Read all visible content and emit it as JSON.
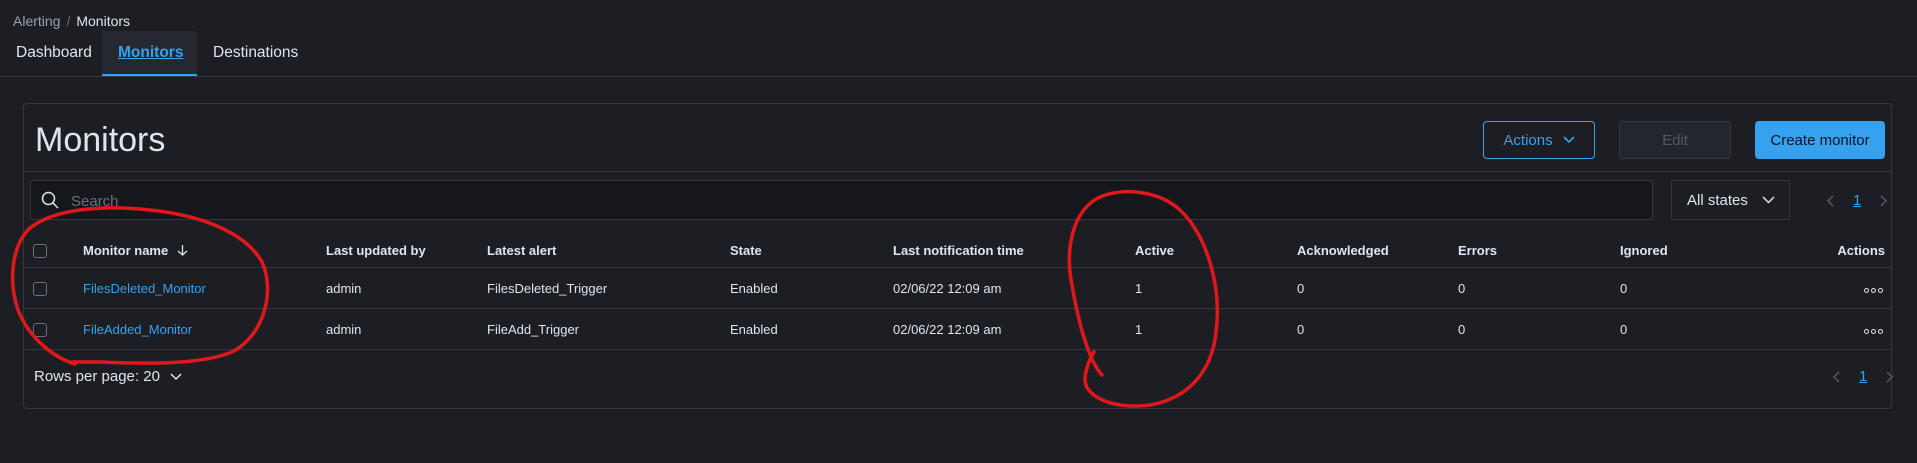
{
  "breadcrumb": {
    "parent": "Alerting",
    "separator": "/",
    "current": "Monitors"
  },
  "tabs": [
    {
      "label": "Dashboard"
    },
    {
      "label": "Monitors",
      "active": true
    },
    {
      "label": "Destinations"
    }
  ],
  "panel": {
    "title": "Monitors",
    "actions_label": "Actions",
    "edit_label": "Edit",
    "create_label": "Create monitor"
  },
  "search": {
    "placeholder": "Search",
    "value": ""
  },
  "state_filter": {
    "selected": "All states"
  },
  "pagination": {
    "current_page": "1"
  },
  "table": {
    "columns": [
      "Monitor name",
      "Last updated by",
      "Latest alert",
      "State",
      "Last notification time",
      "Active",
      "Acknowledged",
      "Errors",
      "Ignored",
      "Actions"
    ],
    "rows": [
      {
        "name": "FilesDeleted_Monitor",
        "updated_by": "admin",
        "latest_alert": "FilesDeleted_Trigger",
        "state": "Enabled",
        "last_notification": "02/06/22 12:09 am",
        "active": "1",
        "acknowledged": "0",
        "errors": "0",
        "ignored": "0"
      },
      {
        "name": "FileAdded_Monitor",
        "updated_by": "admin",
        "latest_alert": "FileAdd_Trigger",
        "state": "Enabled",
        "last_notification": "02/06/22 12:09 am",
        "active": "1",
        "acknowledged": "0",
        "errors": "0",
        "ignored": "0"
      }
    ]
  },
  "rows_per_page": {
    "label": "Rows per page: 20"
  },
  "colors": {
    "accent": "#36a2ef",
    "background": "#1d1e24",
    "annotation": "#e0181b"
  },
  "icons": {
    "search": "search-icon",
    "chevron": "chevron-down-icon",
    "sort": "arrow-down-icon",
    "more": "ellipsis-icon"
  }
}
